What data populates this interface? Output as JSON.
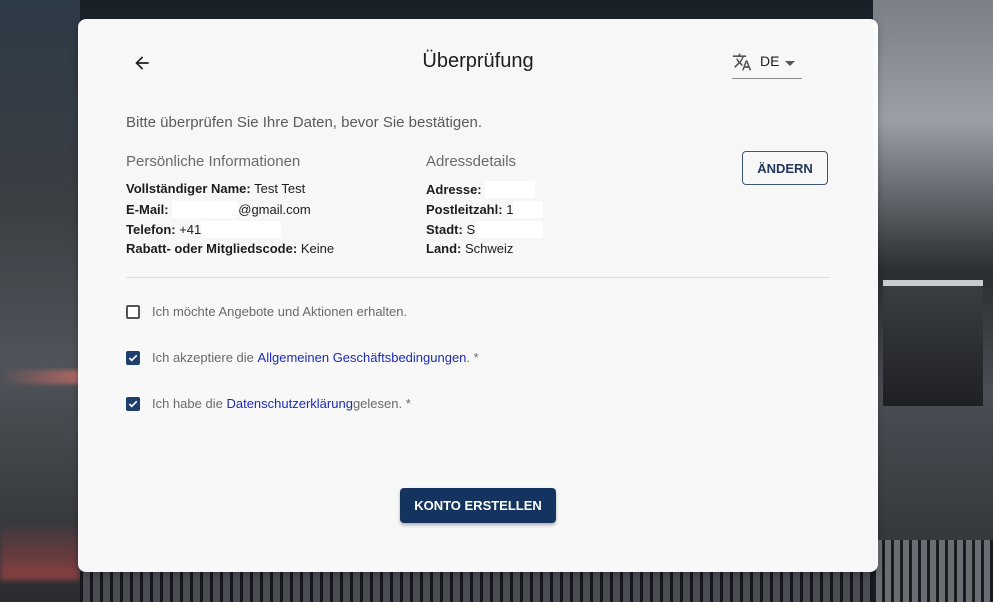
{
  "header": {
    "title": "Überprüfung",
    "language": "DE"
  },
  "intro": "Bitte überprüfen Sie Ihre Daten, bevor Sie bestätigen.",
  "personal": {
    "heading": "Persönliche Informationen",
    "name_label": "Vollständiger Name:",
    "name_value": "Test Test",
    "email_label": "E-Mail:",
    "email_value": "@gmail.com",
    "phone_label": "Telefon:",
    "phone_value": "+41",
    "code_label": "Rabatt- oder Mitgliedscode:",
    "code_value": "Keine"
  },
  "address": {
    "heading": "Adressdetails",
    "address_label": "Adresse:",
    "address_value": "",
    "zip_label": "Postleitzahl:",
    "zip_value": "1",
    "city_label": "Stadt:",
    "city_value": "S",
    "country_label": "Land:",
    "country_value": "Schweiz"
  },
  "change_label": "ÄNDERN",
  "consents": {
    "offers": {
      "text": "Ich möchte Angebote und Aktionen erhalten.",
      "checked": false
    },
    "terms": {
      "prefix": "Ich akzeptiere die ",
      "link": "Allgemeinen Geschäftsbedingungen",
      "suffix": ". *",
      "checked": true
    },
    "privacy": {
      "prefix": "Ich habe die ",
      "link": "Datenschutzerklärung",
      "suffix": " gelesen. *",
      "checked": true
    }
  },
  "submit_label": "KONTO ERSTELLEN",
  "colors": {
    "primary": "#14345f",
    "checkbox": "#1f3f6d",
    "link": "#1d2bb5"
  }
}
